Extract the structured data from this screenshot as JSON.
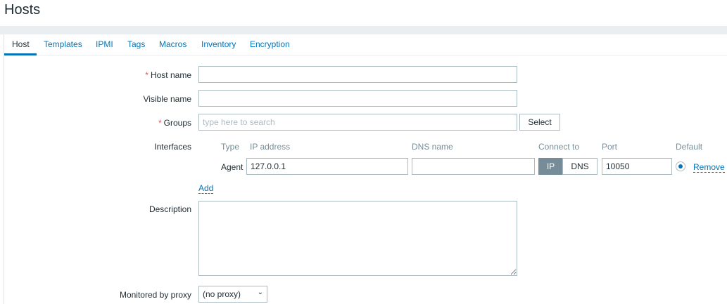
{
  "page": {
    "title": "Hosts"
  },
  "tabs": [
    "Host",
    "Templates",
    "IPMI",
    "Tags",
    "Macros",
    "Inventory",
    "Encryption"
  ],
  "form": {
    "host_name": {
      "label": "Host name",
      "value": ""
    },
    "visible_name": {
      "label": "Visible name",
      "value": ""
    },
    "groups": {
      "label": "Groups",
      "placeholder": "type here to search",
      "select_label": "Select"
    },
    "interfaces": {
      "label": "Interfaces",
      "headers": {
        "type": "Type",
        "ip": "IP address",
        "dns": "DNS name",
        "connect": "Connect to",
        "port": "Port",
        "default": "Default"
      },
      "row": {
        "type": "Agent",
        "ip": "127.0.0.1",
        "dns": "",
        "connect_ip": "IP",
        "connect_dns": "DNS",
        "port": "10050",
        "remove": "Remove"
      },
      "add": "Add"
    },
    "description": {
      "label": "Description",
      "value": ""
    },
    "proxy": {
      "label": "Monitored by proxy",
      "value": "(no proxy)"
    }
  },
  "colors": {
    "accent": "#0275b8",
    "active_toggle": "#768d99",
    "required": "#e45959"
  }
}
